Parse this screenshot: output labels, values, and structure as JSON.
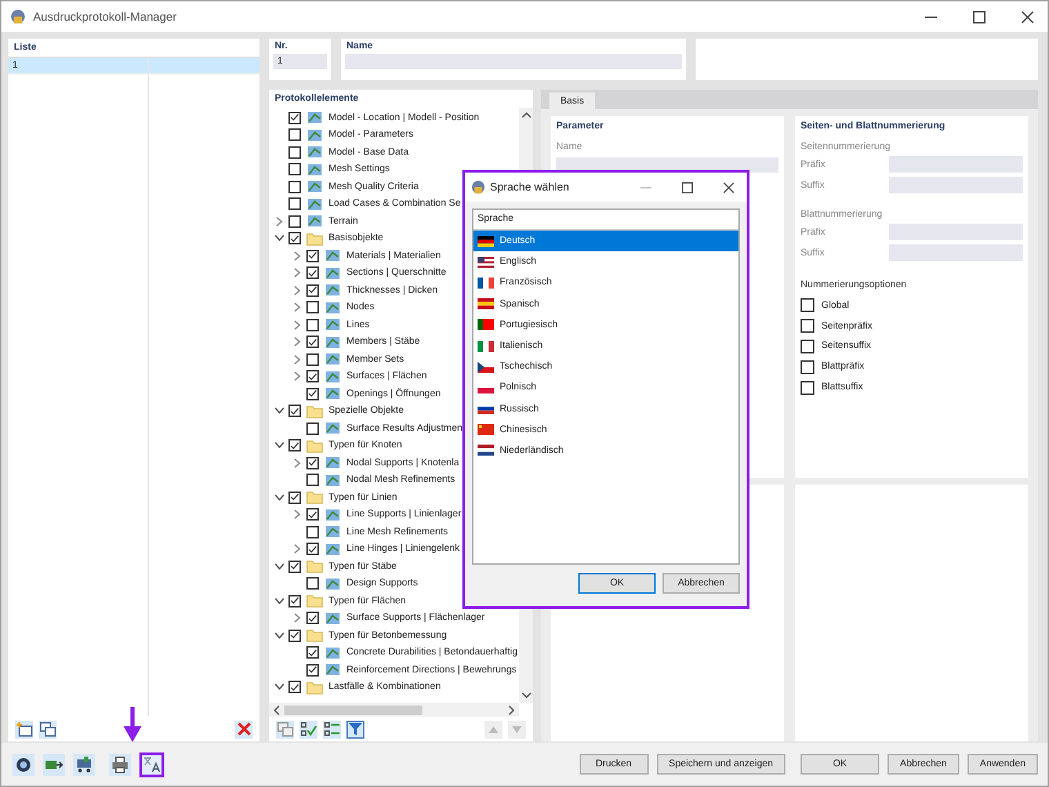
{
  "window": {
    "title": "Ausdruckprotokoll-Manager"
  },
  "list_panel": {
    "header": "Liste",
    "rows": [
      {
        "cell": "1",
        "selected": true
      }
    ]
  },
  "number_field": {
    "label": "Nr.",
    "value": "1"
  },
  "name_field": {
    "label": "Name"
  },
  "elements_panel": {
    "header": "Protokollelemente",
    "tree": [
      {
        "label": "Model - Location | Modell - Position",
        "kind": "item",
        "checked": true
      },
      {
        "label": "Model - Parameters",
        "kind": "item",
        "checked": false
      },
      {
        "label": "Model - Base Data",
        "kind": "item",
        "checked": false
      },
      {
        "label": "Mesh Settings",
        "kind": "item",
        "checked": false
      },
      {
        "label": "Mesh Quality Criteria",
        "kind": "item",
        "checked": false
      },
      {
        "label": "Load Cases & Combination Se",
        "kind": "item",
        "checked": false
      },
      {
        "label": "Terrain",
        "kind": "item",
        "checked": false,
        "expanded": false
      },
      {
        "label": "Basisobjekte",
        "kind": "group",
        "checked": true,
        "expanded": true,
        "children": [
          {
            "label": "Materials | Materialien",
            "kind": "item",
            "checked": true,
            "expanded": false
          },
          {
            "label": "Sections | Querschnitte",
            "kind": "item",
            "checked": true,
            "expanded": false
          },
          {
            "label": "Thicknesses | Dicken",
            "kind": "item",
            "checked": true,
            "expanded": false
          },
          {
            "label": "Nodes",
            "kind": "item",
            "checked": false,
            "expanded": false
          },
          {
            "label": "Lines",
            "kind": "item",
            "checked": false,
            "expanded": false
          },
          {
            "label": "Members | Stäbe",
            "kind": "item",
            "checked": true,
            "expanded": false
          },
          {
            "label": "Member Sets",
            "kind": "item",
            "checked": false,
            "expanded": false
          },
          {
            "label": "Surfaces | Flächen",
            "kind": "item",
            "checked": true,
            "expanded": false
          },
          {
            "label": "Openings | Öffnungen",
            "kind": "item",
            "checked": true
          }
        ]
      },
      {
        "label": "Spezielle Objekte",
        "kind": "group",
        "checked": true,
        "expanded": true,
        "children": [
          {
            "label": "Surface Results Adjustmen",
            "kind": "item",
            "checked": false
          }
        ]
      },
      {
        "label": "Typen für Knoten",
        "kind": "group",
        "checked": true,
        "expanded": true,
        "children": [
          {
            "label": "Nodal Supports | Knotenla",
            "kind": "item",
            "checked": true,
            "expanded": false
          },
          {
            "label": "Nodal Mesh Refinements",
            "kind": "item",
            "checked": false
          }
        ]
      },
      {
        "label": "Typen für Linien",
        "kind": "group",
        "checked": true,
        "expanded": true,
        "children": [
          {
            "label": "Line Supports | Linienlager",
            "kind": "item",
            "checked": true,
            "expanded": false
          },
          {
            "label": "Line Mesh Refinements",
            "kind": "item",
            "checked": false
          },
          {
            "label": "Line Hinges | Liniengelenk",
            "kind": "item",
            "checked": true,
            "expanded": false
          }
        ]
      },
      {
        "label": "Typen für Stäbe",
        "kind": "group",
        "checked": true,
        "expanded": true,
        "children": [
          {
            "label": "Design Supports",
            "kind": "item",
            "checked": false
          }
        ]
      },
      {
        "label": "Typen für Flächen",
        "kind": "group",
        "checked": true,
        "expanded": true,
        "children": [
          {
            "label": "Surface Supports | Flächenlager",
            "kind": "item",
            "checked": true,
            "expanded": false
          }
        ]
      },
      {
        "label": "Typen für Betonbemessung",
        "kind": "group",
        "checked": true,
        "expanded": true,
        "children": [
          {
            "label": "Concrete Durabilities | Betondauerhaftig",
            "kind": "item",
            "checked": true
          },
          {
            "label": "Reinforcement Directions | Bewehrungs",
            "kind": "item",
            "checked": true
          }
        ]
      },
      {
        "label": "Lastfälle & Kombinationen",
        "kind": "group",
        "checked": true,
        "expanded": true
      }
    ]
  },
  "tabs": [
    {
      "label": "Basis",
      "selected": true
    }
  ],
  "parameter_panel": {
    "heading": "Parameter",
    "name_label": "Name"
  },
  "numbering_panel": {
    "heading": "Seiten- und Blattnummerierung",
    "groups": [
      {
        "label": "Seitennummerierung",
        "fields": [
          "Präfix",
          "Suffix"
        ]
      },
      {
        "label": "Blattnummerierung",
        "fields": [
          "Präfix",
          "Suffix"
        ]
      }
    ],
    "options_label": "Nummerierungsoptionen",
    "options": [
      {
        "label": "Global",
        "checked": false
      },
      {
        "label": "Seitenpräfix",
        "checked": false
      },
      {
        "label": "Seitensuffix",
        "checked": false
      },
      {
        "label": "Blattpräfix",
        "checked": false
      },
      {
        "label": "Blattsuffix",
        "checked": false
      }
    ]
  },
  "dialog": {
    "title": "Sprache wählen",
    "column": "Sprache",
    "languages": [
      {
        "label": "Deutsch",
        "selected": true
      },
      {
        "label": "Englisch",
        "selected": false
      },
      {
        "label": "Französisch",
        "selected": false
      },
      {
        "label": "Spanisch",
        "selected": false
      },
      {
        "label": "Portugiesisch",
        "selected": false
      },
      {
        "label": "Italienisch",
        "selected": false
      },
      {
        "label": "Tschechisch",
        "selected": false
      },
      {
        "label": "Polnisch",
        "selected": false
      },
      {
        "label": "Russisch",
        "selected": false
      },
      {
        "label": "Chinesisch",
        "selected": false
      },
      {
        "label": "Niederländisch",
        "selected": false
      }
    ],
    "buttons": [
      "OK",
      "Abbrechen"
    ]
  },
  "buttons": [
    "Drucken",
    "Speichern und anzeigen",
    "OK",
    "Abbrechen",
    "Anwenden"
  ]
}
